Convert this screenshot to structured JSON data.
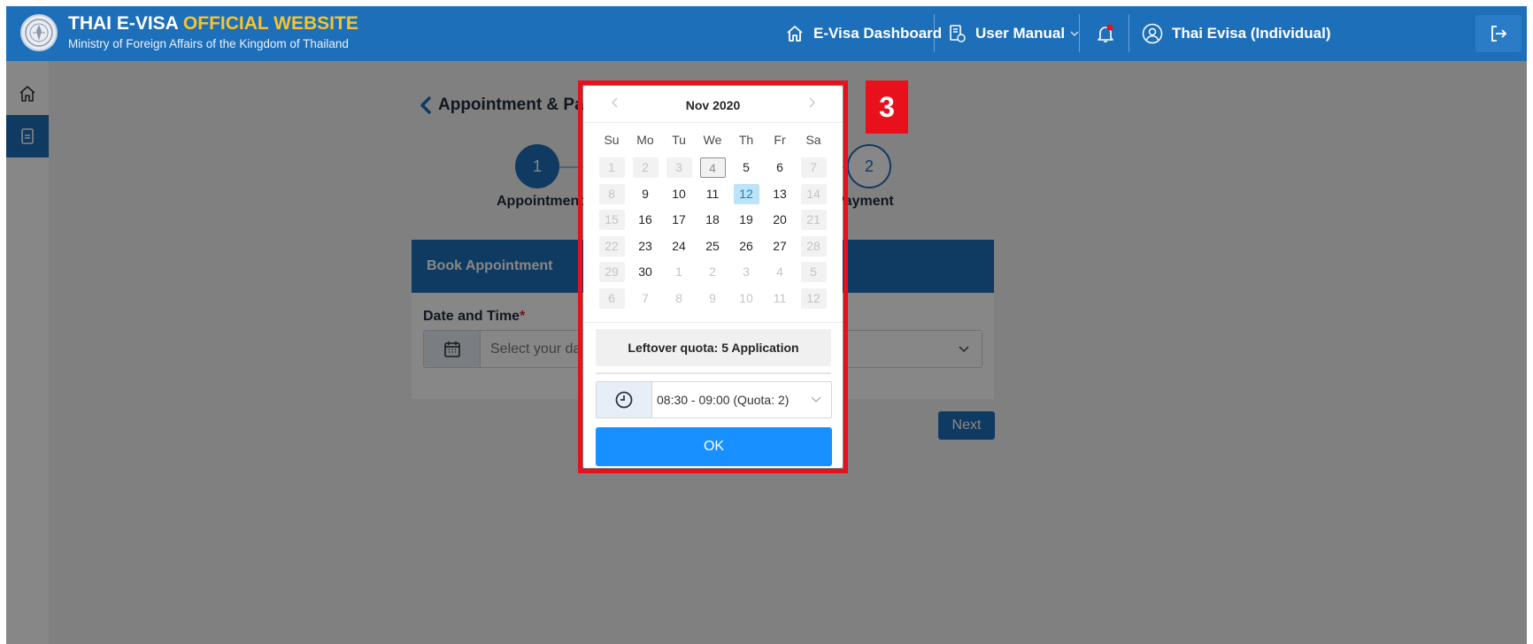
{
  "header": {
    "title_part1": "THAI E-VISA ",
    "title_part2": "OFFICIAL WEBSITE",
    "subtitle": "Ministry of Foreign Affairs of the Kingdom of Thailand",
    "nav_dashboard": "E-Visa Dashboard",
    "nav_manual": "User Manual",
    "nav_user": "Thai Evisa (Individual)",
    "accent_color": "#f4c430",
    "brand_color": "#1e6fba"
  },
  "page": {
    "title": "Appointment & Payr",
    "step1_number": "1",
    "step1_label": "Appointment",
    "step2_number": "2",
    "step2_label": "Payment",
    "card_title": "Book Appointment",
    "field_label": "Date and Time",
    "required_mark": "*",
    "select_placeholder": "Select your da",
    "next_label": "Next"
  },
  "calendar": {
    "month_label": "Nov 2020",
    "weekdays": [
      "Su",
      "Mo",
      "Tu",
      "We",
      "Th",
      "Fr",
      "Sa"
    ],
    "weeks": [
      [
        {
          "d": "1",
          "s": "disabled"
        },
        {
          "d": "2",
          "s": "disabled"
        },
        {
          "d": "3",
          "s": "disabled"
        },
        {
          "d": "4",
          "s": "today"
        },
        {
          "d": "5",
          "s": ""
        },
        {
          "d": "6",
          "s": ""
        },
        {
          "d": "7",
          "s": "disabled"
        }
      ],
      [
        {
          "d": "8",
          "s": "disabled"
        },
        {
          "d": "9",
          "s": ""
        },
        {
          "d": "10",
          "s": ""
        },
        {
          "d": "11",
          "s": ""
        },
        {
          "d": "12",
          "s": "selected"
        },
        {
          "d": "13",
          "s": ""
        },
        {
          "d": "14",
          "s": "disabled"
        }
      ],
      [
        {
          "d": "15",
          "s": "disabled"
        },
        {
          "d": "16",
          "s": ""
        },
        {
          "d": "17",
          "s": ""
        },
        {
          "d": "18",
          "s": ""
        },
        {
          "d": "19",
          "s": ""
        },
        {
          "d": "20",
          "s": ""
        },
        {
          "d": "21",
          "s": "disabled"
        }
      ],
      [
        {
          "d": "22",
          "s": "disabled"
        },
        {
          "d": "23",
          "s": ""
        },
        {
          "d": "24",
          "s": ""
        },
        {
          "d": "25",
          "s": ""
        },
        {
          "d": "26",
          "s": ""
        },
        {
          "d": "27",
          "s": ""
        },
        {
          "d": "28",
          "s": "disabled"
        }
      ],
      [
        {
          "d": "29",
          "s": "disabled"
        },
        {
          "d": "30",
          "s": ""
        },
        {
          "d": "1",
          "s": "other"
        },
        {
          "d": "2",
          "s": "other"
        },
        {
          "d": "3",
          "s": "other"
        },
        {
          "d": "4",
          "s": "other"
        },
        {
          "d": "5",
          "s": "disabled"
        }
      ],
      [
        {
          "d": "6",
          "s": "disabled"
        },
        {
          "d": "7",
          "s": "other"
        },
        {
          "d": "8",
          "s": "other"
        },
        {
          "d": "9",
          "s": "other"
        },
        {
          "d": "10",
          "s": "other"
        },
        {
          "d": "11",
          "s": "other"
        },
        {
          "d": "12",
          "s": "disabled"
        }
      ]
    ],
    "quota_text": "Leftover quota: 5 Application",
    "time_value": "08:30 - 09:00 (Quota: 2)",
    "ok_label": "OK"
  },
  "annotation": {
    "badge": "3",
    "color": "#e8101a"
  }
}
